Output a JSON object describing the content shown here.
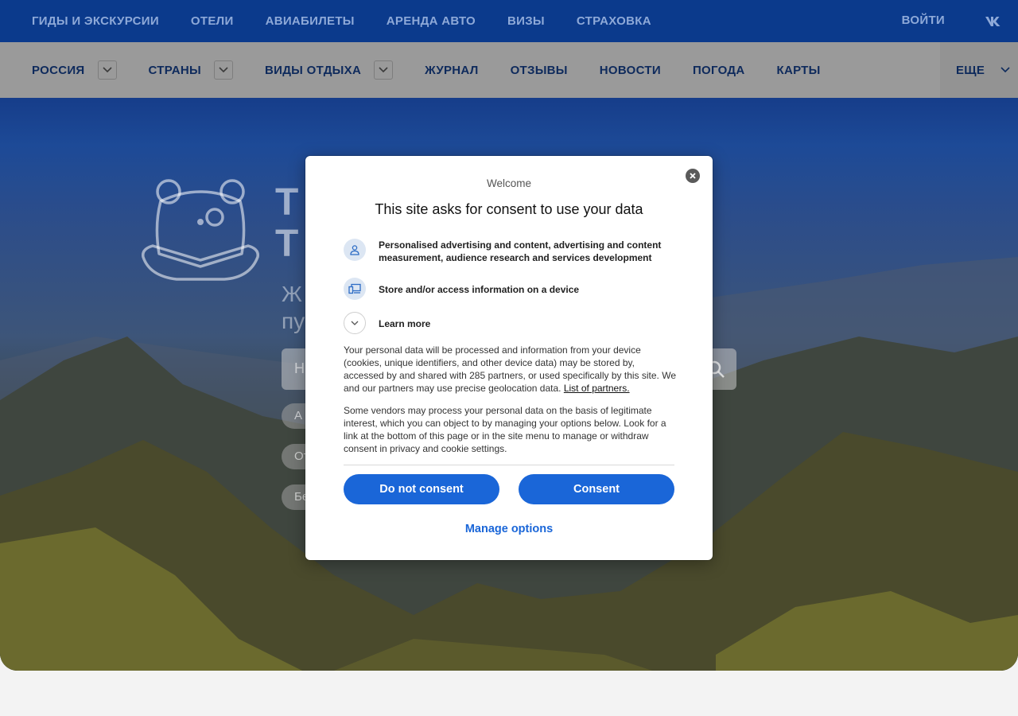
{
  "topnav": {
    "items": [
      "ГИДЫ И ЭКСКУРСИИ",
      "ОТЕЛИ",
      "АВИАБИЛЕТЫ",
      "АРЕНДА АВТО",
      "ВИЗЫ",
      "СТРАХОВКА"
    ],
    "login": "ВОЙТИ",
    "social_icon": "vk-icon"
  },
  "subnav": {
    "items": [
      {
        "label": "РОССИЯ",
        "dropdown": true
      },
      {
        "label": "СТРАНЫ",
        "dropdown": true
      },
      {
        "label": "ВИДЫ ОТДЫХА",
        "dropdown": true
      },
      {
        "label": "ЖУРНАЛ",
        "dropdown": false
      },
      {
        "label": "ОТЗЫВЫ",
        "dropdown": false
      },
      {
        "label": "НОВОСТИ",
        "dropdown": false
      },
      {
        "label": "ПОГОДА",
        "dropdown": false
      },
      {
        "label": "КАРТЫ",
        "dropdown": false
      }
    ],
    "more": "ЕЩЕ"
  },
  "hero": {
    "title_line1": "Т",
    "title_line2": "Т",
    "subtitle_line1": "Ж",
    "subtitle_line2": "пу",
    "search_placeholder": "Н",
    "chips": [
      "А",
      "От",
      "Бе"
    ]
  },
  "consent": {
    "welcome": "Welcome",
    "title": "This site asks for consent to use your data",
    "purposes": [
      {
        "icon": "person-icon",
        "text": "Personalised advertising and content, advertising and content measurement, audience research and services development"
      },
      {
        "icon": "devices-icon",
        "text": "Store and/or access information on a device"
      }
    ],
    "learn_more": "Learn more",
    "paragraph1": "Your personal data will be processed and information from your device (cookies, unique identifiers, and other device data) may be stored by, accessed by and shared with 285 partners, or used specifically by this site. We and our partners may use precise geolocation data.",
    "partners_link": "List of partners.",
    "paragraph2": "Some vendors may process your personal data on the basis of legitimate interest, which you can object to by managing your options below. Look for a link at the bottom of this page or in the site menu to manage or withdraw consent in privacy and cookie settings.",
    "do_not_consent": "Do not consent",
    "consent": "Consent",
    "manage_options": "Manage options"
  },
  "colors": {
    "topbar": "#0b3a8c",
    "button": "#1a66d8"
  }
}
